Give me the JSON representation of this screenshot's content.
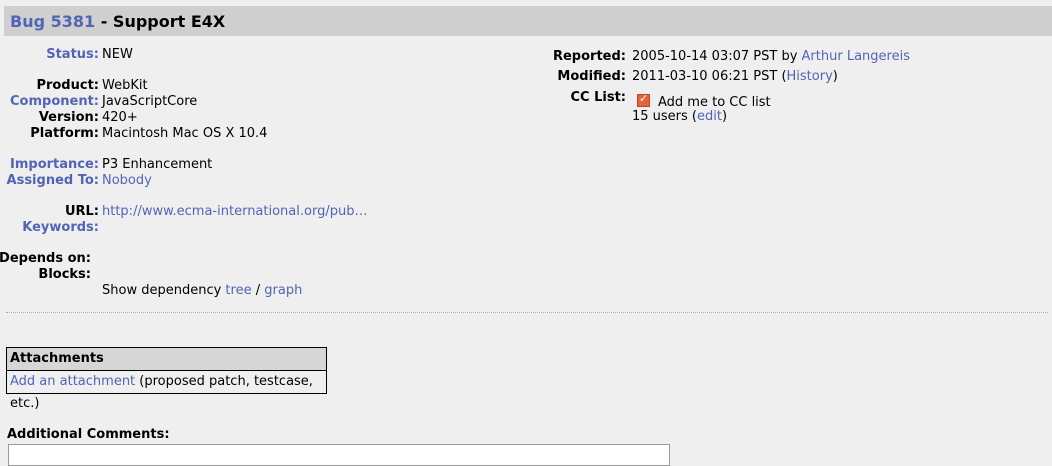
{
  "header": {
    "bug_link": "Bug 5381",
    "title_suffix": " - Support E4X"
  },
  "fields": {
    "status": {
      "label": "Status:",
      "value": "NEW"
    },
    "product": {
      "label": "Product:",
      "value": "WebKit"
    },
    "component": {
      "label": "Component:",
      "value": "JavaScriptCore"
    },
    "version": {
      "label": "Version:",
      "value": "420+"
    },
    "platform": {
      "label": "Platform:",
      "value": "Macintosh Mac OS X 10.4"
    },
    "importance": {
      "label": "Importance:",
      "value": "P3 Enhancement"
    },
    "assigned_to": {
      "label": "Assigned To:",
      "value": "Nobody"
    },
    "url": {
      "label": "URL:",
      "value": "http://www.ecma-international.org/pub…"
    },
    "keywords": {
      "label": "Keywords:",
      "value": ""
    },
    "depends_on": {
      "label": "Depends on:"
    },
    "blocks": {
      "label": "Blocks:"
    },
    "dependency": {
      "prefix": "Show dependency",
      "tree": "tree",
      "slash": "/",
      "graph": "graph"
    }
  },
  "meta": {
    "reported": {
      "label": "Reported:",
      "value": "2005-10-14 03:07 PST by",
      "user": "Arthur Langereis"
    },
    "modified": {
      "label": "Modified:",
      "value": "2011-03-10 06:21 PST (",
      "history": "History",
      "close": ")"
    },
    "cc": {
      "label": "CC List:",
      "checkbox_label": "Add me to CC list",
      "users": "15 users (",
      "edit": "edit",
      "close": ")"
    }
  },
  "attachments": {
    "header": "Attachments",
    "add_link": "Add an attachment",
    "add_suffix": " (proposed patch, testcase, etc.)"
  },
  "comments": {
    "label": "Additional Comments:"
  },
  "colors": {
    "link": "#5165b5",
    "title_bar": "#cfcfcf",
    "background": "#efefef"
  }
}
